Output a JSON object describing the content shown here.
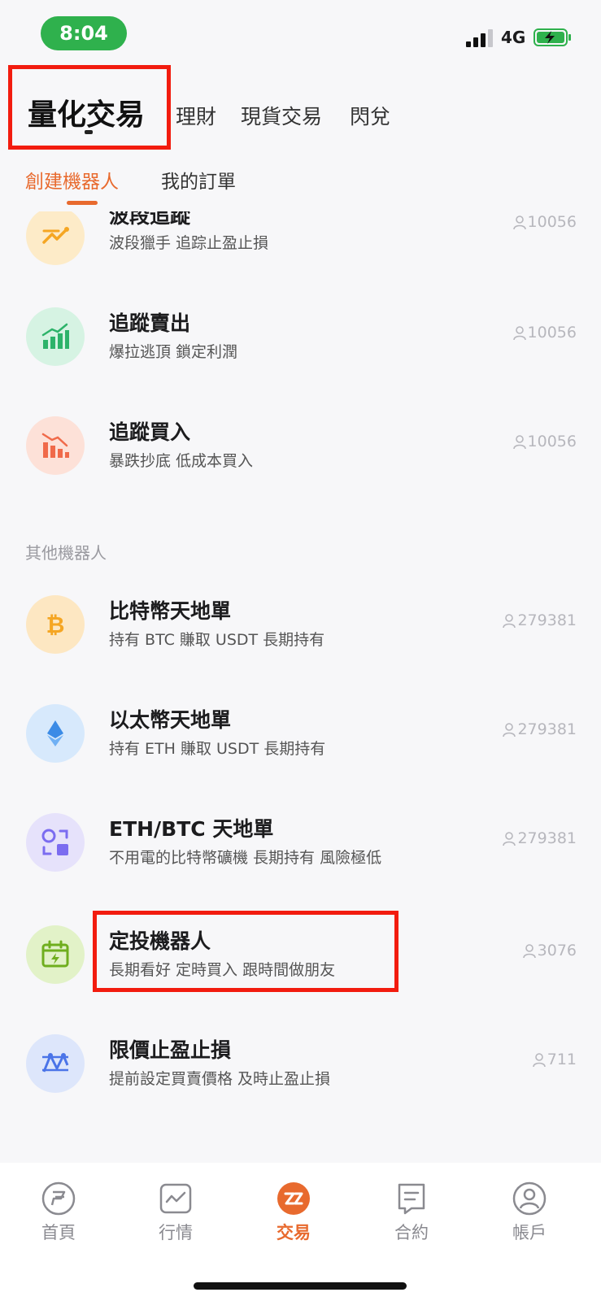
{
  "status_bar": {
    "time": "8:04",
    "network": "4G"
  },
  "top_tabs": [
    {
      "label": "量化交易",
      "active": true
    },
    {
      "label": "理財"
    },
    {
      "label": "現貨交易"
    },
    {
      "label": "閃兌"
    }
  ],
  "sub_tabs": [
    {
      "label": "創建機器人",
      "active": true
    },
    {
      "label": "我的訂單"
    }
  ],
  "bots": [
    {
      "title": "波段追蹤",
      "subtitle": "波段獵手 追踪止盈止損",
      "count": "10056",
      "icon": "swing-tracking-icon",
      "color": "#f5a623"
    },
    {
      "title": "追蹤賣出",
      "subtitle": "爆拉逃頂 鎖定利潤",
      "count": "10056",
      "icon": "trend-up-bars-icon",
      "color": "#2db36a"
    },
    {
      "title": "追蹤買入",
      "subtitle": "暴跌抄底 低成本買入",
      "count": "10056",
      "icon": "trend-down-bars-icon",
      "color": "#f06a4a"
    }
  ],
  "other_section_label": "其他機器人",
  "other_bots": [
    {
      "title": "比特幣天地單",
      "subtitle": "持有 BTC 賺取 USDT 長期持有",
      "count": "279381",
      "icon": "bitcoin-icon",
      "color": "#f5a623"
    },
    {
      "title": "以太幣天地單",
      "subtitle": "持有 ETH 賺取 USDT 長期持有",
      "count": "279381",
      "icon": "ethereum-icon",
      "color": "#3b8be6"
    },
    {
      "title": "ETH/BTC 天地單",
      "subtitle": "不用電的比特幣礦機 長期持有 風險極低",
      "count": "279381",
      "icon": "swap-squares-icon",
      "color": "#7b6cf0"
    },
    {
      "title": "定投機器人",
      "subtitle": "長期看好 定時買入 跟時間做朋友",
      "count": "3076",
      "icon": "calendar-bolt-icon",
      "color": "#6fae1e"
    },
    {
      "title": "限價止盈止損",
      "subtitle": "提前設定買賣價格 及時止盈止損",
      "count": "711",
      "icon": "limit-price-icon",
      "color": "#4a74e8"
    }
  ],
  "bottom_nav": [
    {
      "label": "首頁",
      "icon": "home-icon"
    },
    {
      "label": "行情",
      "icon": "market-chart-icon"
    },
    {
      "label": "交易",
      "icon": "trade-icon",
      "active": true
    },
    {
      "label": "合約",
      "icon": "contract-icon"
    },
    {
      "label": "帳戶",
      "icon": "account-icon"
    }
  ],
  "colors": {
    "accent": "#e86a2e",
    "highlight": "#f21c0f",
    "status_green": "#2fb14d"
  }
}
